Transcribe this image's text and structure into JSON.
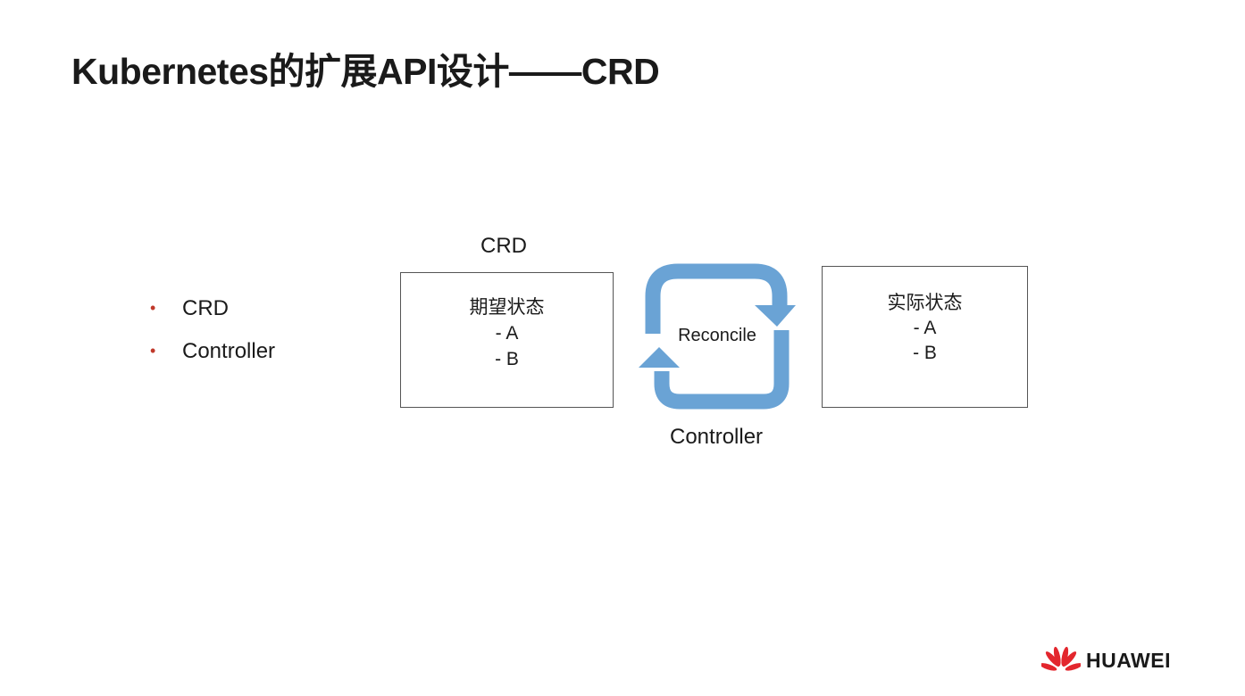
{
  "slide": {
    "title": "Kubernetes的扩展API设计——CRD"
  },
  "bullets": {
    "marker": "•",
    "items": [
      {
        "label": "CRD"
      },
      {
        "label": "Controller"
      }
    ]
  },
  "diagram": {
    "desired_box": {
      "caption": "CRD",
      "title": "期望状态",
      "items": [
        "- A",
        "- B"
      ]
    },
    "cycle": {
      "label": "Reconcile",
      "caption": "Controller",
      "color": "#6aa3d5"
    },
    "actual_box": {
      "title": "实际状态",
      "items": [
        "- A",
        "- B"
      ]
    }
  },
  "brand": {
    "name": "HUAWEI",
    "color": "#e3262d",
    "icon": "huawei-petal-logo"
  }
}
